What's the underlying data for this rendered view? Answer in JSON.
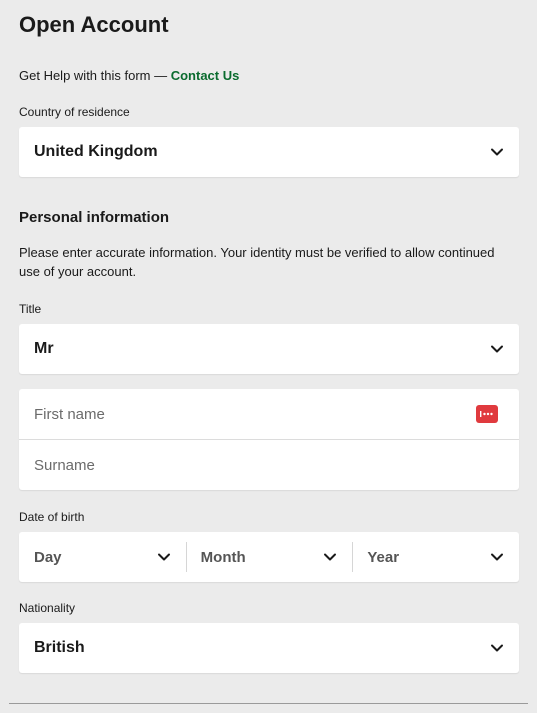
{
  "header": {
    "title": "Open Account",
    "help_text": "Get Help with this form — ",
    "help_link": "Contact Us"
  },
  "country": {
    "label": "Country of residence",
    "value": "United Kingdom"
  },
  "personal": {
    "heading": "Personal information",
    "description": "Please enter accurate information. Your identity must be verified to allow continued use of your account."
  },
  "title_field": {
    "label": "Title",
    "value": "Mr"
  },
  "name": {
    "first_placeholder": "First name",
    "surname_placeholder": "Surname"
  },
  "dob": {
    "label": "Date of birth",
    "day": "Day",
    "month": "Month",
    "year": "Year"
  },
  "nationality": {
    "label": "Nationality",
    "value": "British"
  },
  "colors": {
    "background": "#ebebeb",
    "link": "#0a6b2e",
    "password_manager_icon": "#e03a3e"
  },
  "icons": {
    "dropdown": "chevron-down-icon",
    "password_manager": "password-manager-icon"
  }
}
